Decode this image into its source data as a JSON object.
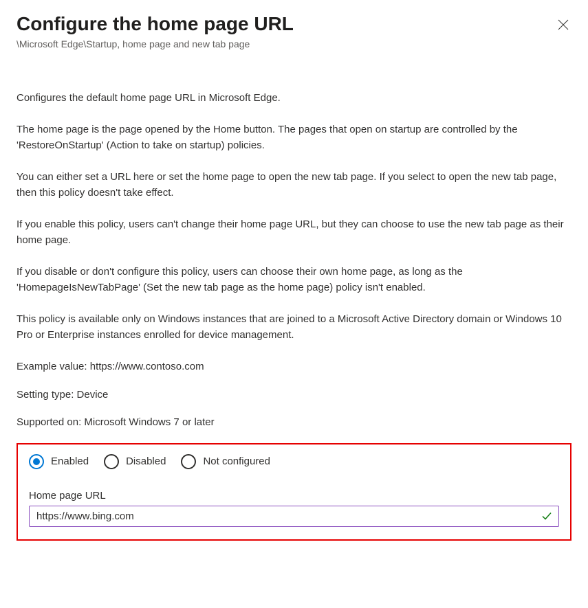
{
  "header": {
    "title": "Configure the home page URL",
    "breadcrumb": "\\Microsoft Edge\\Startup, home page and new tab page"
  },
  "description": {
    "p1": "Configures the default home page URL in Microsoft Edge.",
    "p2": "The home page is the page opened by the Home button. The pages that open on startup are controlled by the 'RestoreOnStartup' (Action to take on startup) policies.",
    "p3": "You can either set a URL here or set the home page to open the new tab page. If you select to open the new tab page, then this policy doesn't take effect.",
    "p4": "If you enable this policy, users can't change their home page URL, but they can choose to use the new tab page as their home page.",
    "p5": "If you disable or don't configure this policy, users can choose their own home page, as long as the 'HomepageIsNewTabPage' (Set the new tab page as the home page) policy isn't enabled.",
    "p6": "This policy is available only on Windows instances that are joined to a Microsoft Active Directory domain or Windows 10 Pro or Enterprise instances enrolled for device management.",
    "example": "Example value: https://www.contoso.com",
    "setting_type": "Setting type: Device",
    "supported_on": "Supported on: Microsoft Windows 7 or later"
  },
  "form": {
    "radio": {
      "enabled": "Enabled",
      "disabled": "Disabled",
      "not_configured": "Not configured",
      "selected": "enabled"
    },
    "url_field": {
      "label": "Home page URL",
      "value": "https://www.bing.com"
    }
  }
}
